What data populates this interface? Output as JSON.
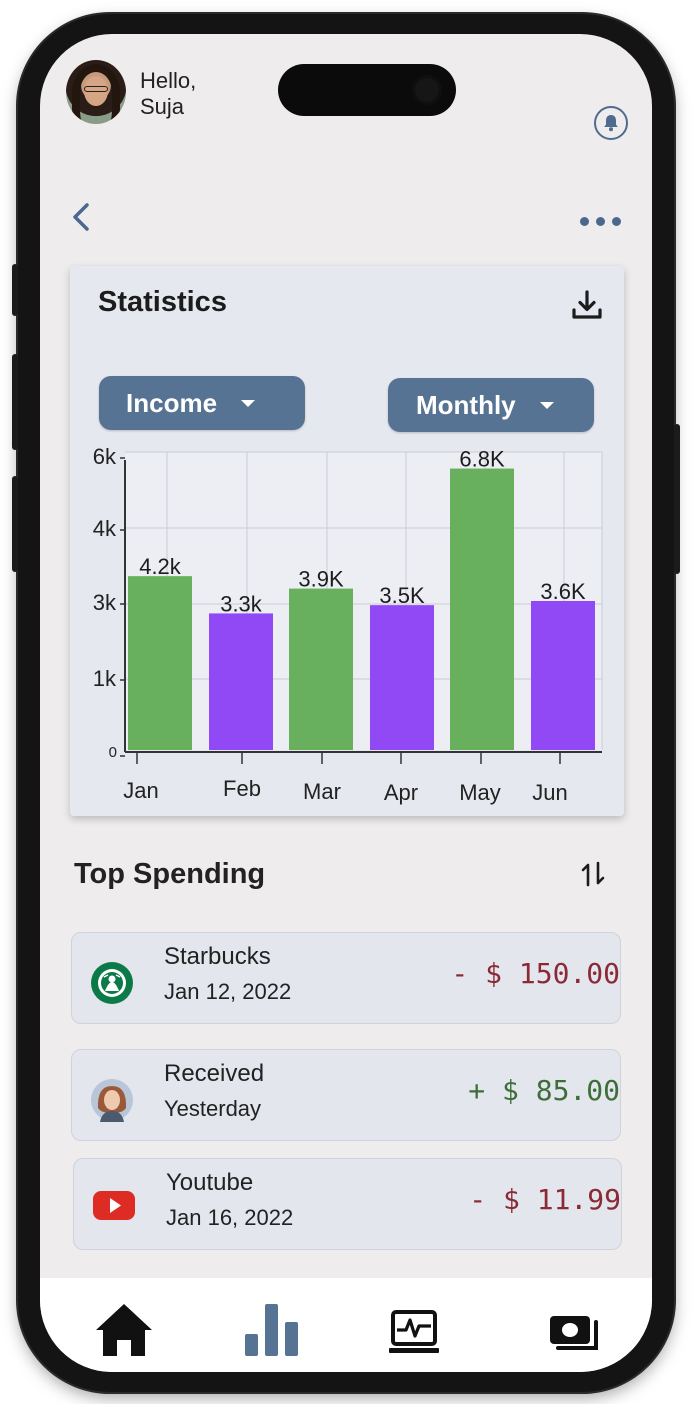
{
  "header": {
    "greeting_line1": "Hello,",
    "greeting_line2": "Suja"
  },
  "statistics": {
    "title": "Statistics",
    "type_dropdown": {
      "selected": "Income"
    },
    "period_dropdown": {
      "selected": "Monthly"
    }
  },
  "chart_data": {
    "type": "bar",
    "categories": [
      "Jan",
      "Feb",
      "Mar",
      "Apr",
      "May",
      "Jun"
    ],
    "values": [
      4.2,
      3.3,
      3.9,
      3.5,
      6.8,
      3.6
    ],
    "data_labels": [
      "4.2k",
      "3.3k",
      "3.9K",
      "3.5K",
      "6.8K",
      "3.6K"
    ],
    "y_ticks": [
      "0",
      "1k",
      "3k",
      "4k",
      "6k"
    ],
    "ylim": [
      0,
      7.2
    ],
    "grid": true,
    "colors": [
      "#68b05d",
      "#9149f6",
      "#68b05d",
      "#9149f6",
      "#68b05d",
      "#9149f6"
    ]
  },
  "top_spending": {
    "title": "Top Spending",
    "transactions": [
      {
        "name": "Starbucks",
        "date": "Jan 12, 2022",
        "amount": "- $ 150.00",
        "icon": "starbucks-logo-icon"
      },
      {
        "name": "Received",
        "date": "Yesterday",
        "amount": "+ $ 85.00",
        "icon": "person-avatar-icon"
      },
      {
        "name": "Youtube",
        "date": "Jan 16, 2022",
        "amount": "- $ 11.99",
        "icon": "youtube-logo-icon"
      }
    ]
  },
  "nav": {
    "items": [
      "home-icon",
      "bar-chart-icon",
      "activity-monitor-icon",
      "wallet-cash-icon"
    ]
  },
  "colors": {
    "accent": "#567394",
    "income_bar": "#68b05d",
    "expense_bar": "#9149f6",
    "negative_amount": "#8b2a34",
    "positive_amount": "#3d6e3a"
  }
}
